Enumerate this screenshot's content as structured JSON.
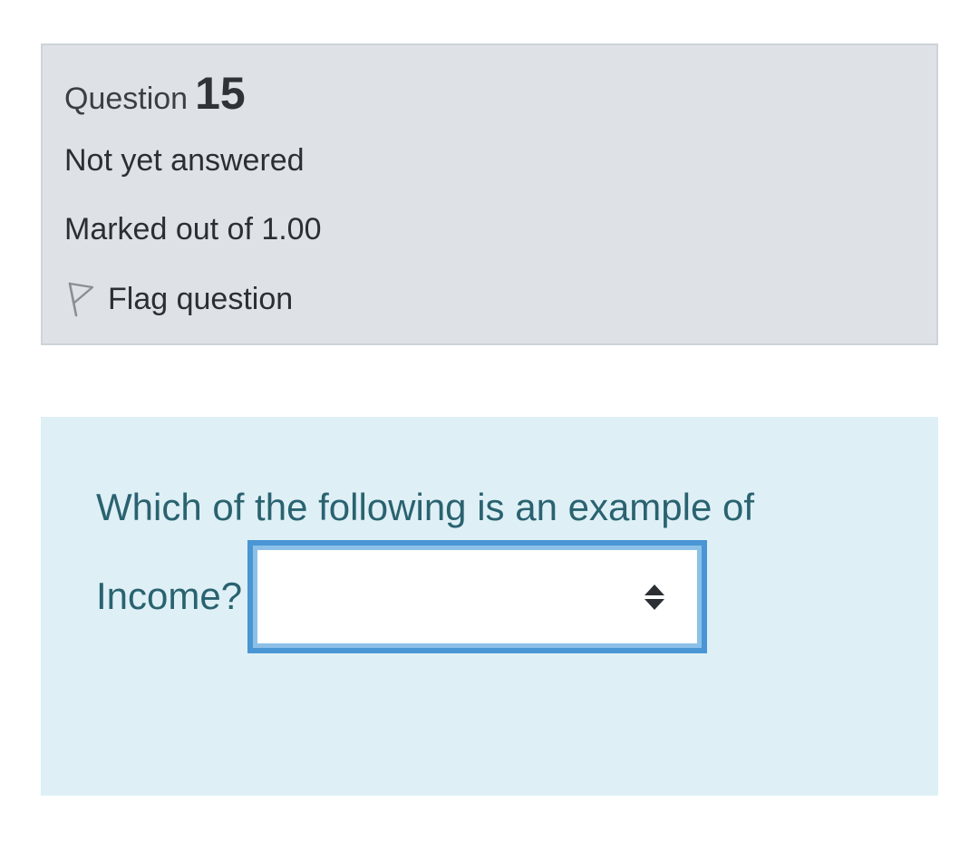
{
  "question": {
    "word": "Question",
    "number": "15",
    "state": "Not yet answered",
    "grade": "Marked out of 1.00",
    "flag_label": "Flag question",
    "flag_icon": "flag-outline-icon"
  },
  "content": {
    "text_line1": "Which of the following is an example of",
    "text_line2": "Income?",
    "select_value": "",
    "select_icon": "sort-arrows-icon"
  },
  "colors": {
    "info_bg": "#dee2e6",
    "content_bg": "#def0f6",
    "question_text": "#2a6270",
    "focus_border": "#4a96d4"
  }
}
